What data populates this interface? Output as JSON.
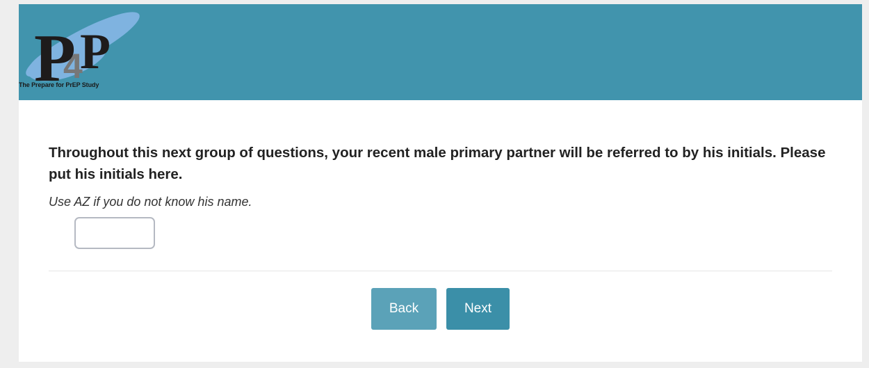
{
  "header": {
    "logo_caption": "The Prepare for PrEP Study",
    "logo_letters": {
      "first": "P",
      "middle": "4",
      "last": "P"
    },
    "background_color": "#4194ad"
  },
  "question": {
    "prompt": "Throughout this next group of questions, your recent male primary partner will be referred to by his initials.  Please put his initials here.",
    "hint": "Use AZ if you do not know his name.",
    "input_value": "",
    "input_placeholder": ""
  },
  "navigation": {
    "back_label": "Back",
    "next_label": "Next",
    "back_color": "#5ba2b8",
    "next_color": "#3b8fa8"
  }
}
